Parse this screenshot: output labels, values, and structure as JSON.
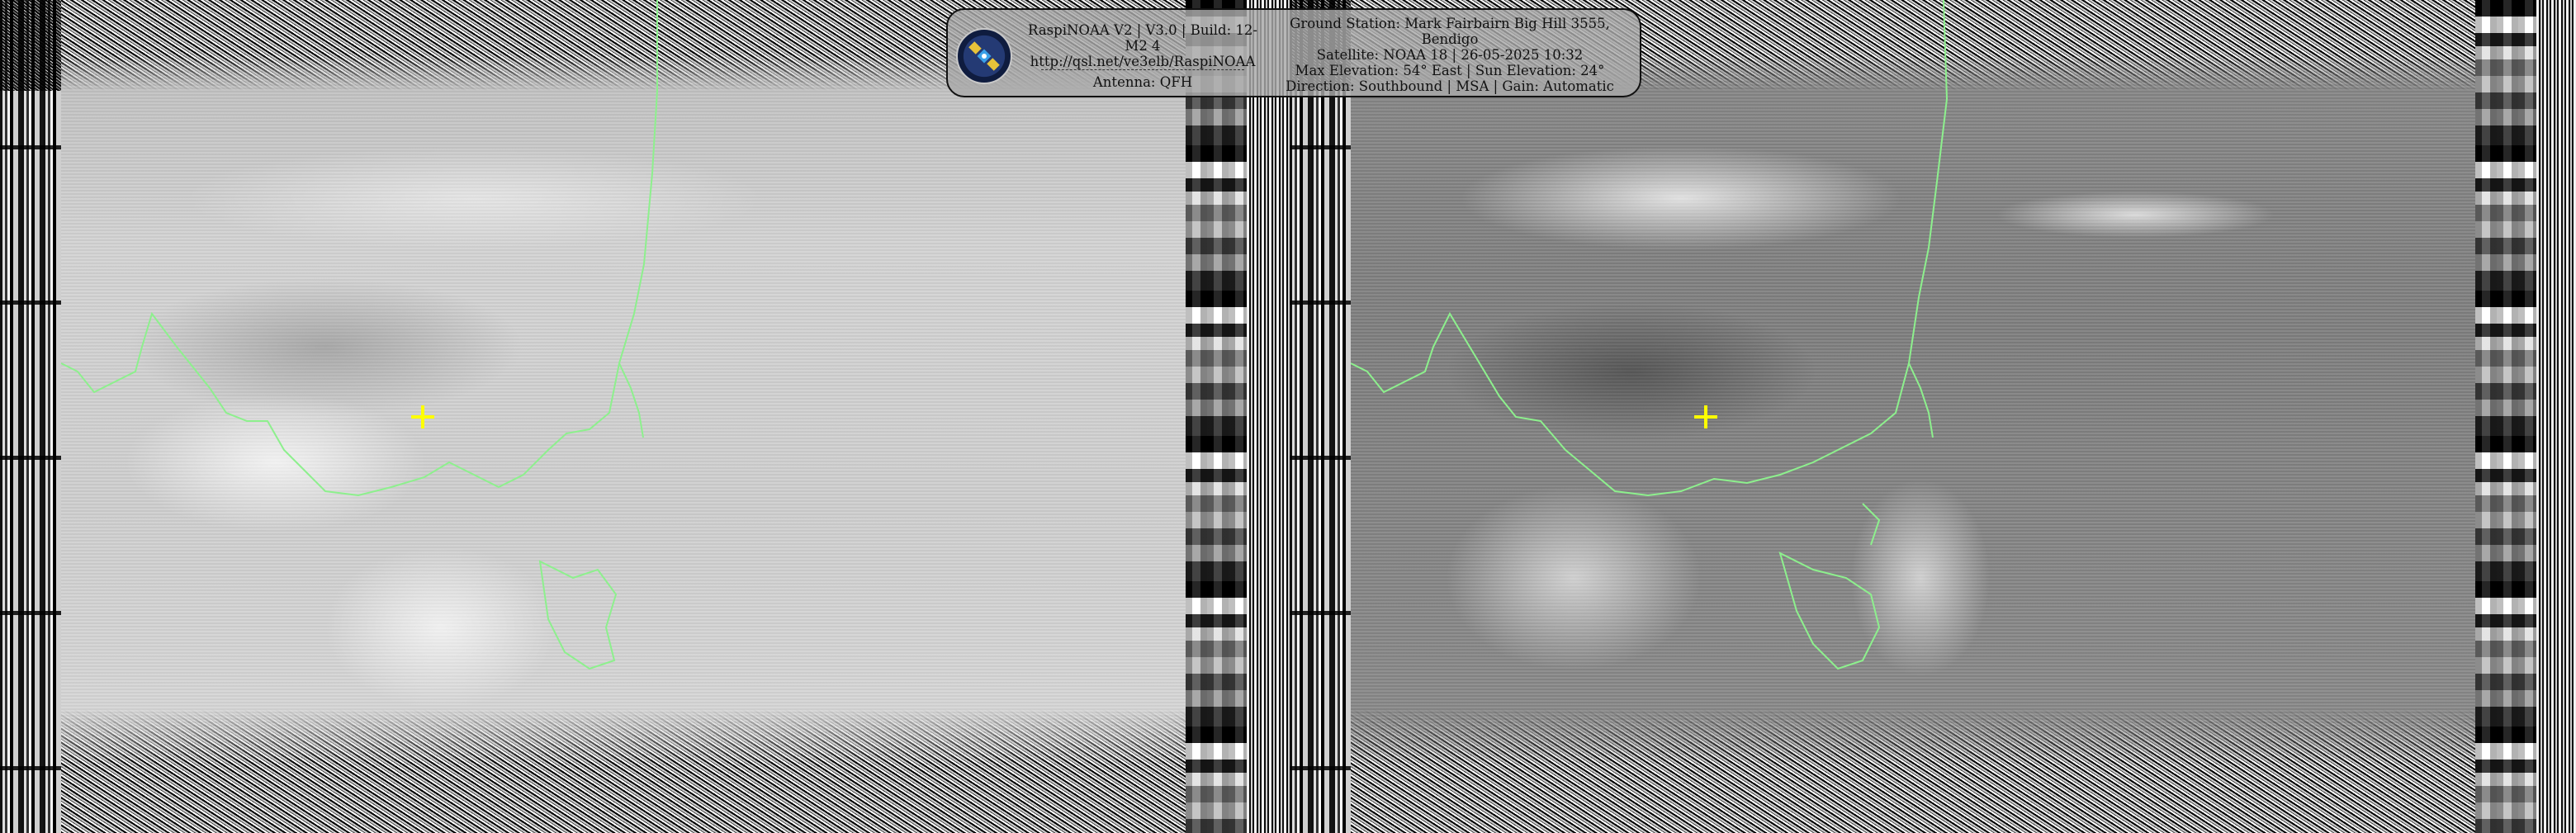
{
  "info": {
    "app_line": "RaspiNOAA V2 | V3.0 | Build: 12-M2 4",
    "url_line": "http://qsl.net/ve3elb/RaspiNOAA",
    "antenna_line": "Antenna: QFH",
    "station_line": "Ground Station: Mark Fairbairn Big Hill 3555, Bendigo",
    "satellite_line": "Satellite: NOAA 18 | 26-05-2025 10:32",
    "elevation_line": "Max Elevation: 54° East | Sun Elevation: 24°",
    "direction_line": "Direction: Southbound | MSA | Gain: Automatic"
  },
  "icons": {
    "logo": "satellite-icon",
    "ground_station_marker": "crosshair-plus-icon"
  },
  "colors": {
    "coastline": "#8df08d",
    "marker": "#ffff00",
    "box_border": "#111111"
  }
}
